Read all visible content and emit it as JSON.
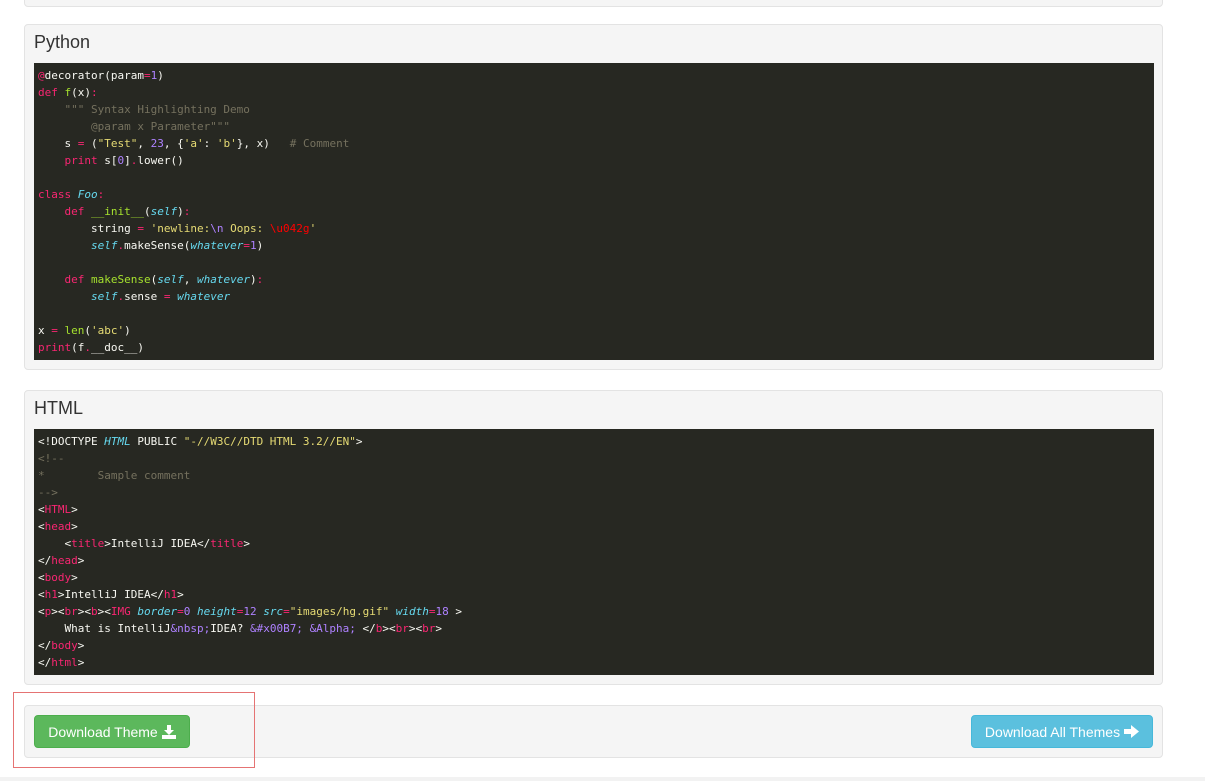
{
  "sections": [
    {
      "title": "Python",
      "lines": [
        [
          [
            "kw",
            "@"
          ],
          [
            "plain",
            "decorator(param"
          ],
          [
            "kw",
            "="
          ],
          [
            "num",
            "1"
          ],
          [
            "plain",
            ")"
          ]
        ],
        [
          [
            "kw",
            "def "
          ],
          [
            "func",
            "f"
          ],
          [
            "plain",
            "(x)"
          ],
          [
            "kw",
            ":"
          ]
        ],
        [
          [
            "comment",
            "    \"\"\" Syntax Highlighting Demo"
          ]
        ],
        [
          [
            "comment",
            "        @param x Parameter\"\"\""
          ]
        ],
        [
          [
            "plain",
            "    s "
          ],
          [
            "kw",
            "="
          ],
          [
            "plain",
            " ("
          ],
          [
            "str",
            "\"Test\""
          ],
          [
            "plain",
            ", "
          ],
          [
            "num",
            "23"
          ],
          [
            "plain",
            ", {"
          ],
          [
            "str",
            "'a'"
          ],
          [
            "plain",
            ": "
          ],
          [
            "str",
            "'b'"
          ],
          [
            "plain",
            "}, x)   "
          ],
          [
            "comment",
            "# Comment"
          ]
        ],
        [
          [
            "plain",
            "    "
          ],
          [
            "kw",
            "print"
          ],
          [
            "plain",
            " s["
          ],
          [
            "num",
            "0"
          ],
          [
            "plain",
            "]"
          ],
          [
            "kw",
            "."
          ],
          [
            "plain",
            "lower()"
          ]
        ],
        [],
        [
          [
            "kw",
            "class "
          ],
          [
            "cls",
            "Foo"
          ],
          [
            "kw",
            ":"
          ]
        ],
        [
          [
            "plain",
            "    "
          ],
          [
            "kw",
            "def "
          ],
          [
            "func",
            "__init__"
          ],
          [
            "plain",
            "("
          ],
          [
            "self",
            "self"
          ],
          [
            "plain",
            ")"
          ],
          [
            "kw",
            ":"
          ]
        ],
        [
          [
            "plain",
            "        string "
          ],
          [
            "kw",
            "="
          ],
          [
            "plain",
            " "
          ],
          [
            "str",
            "'newline:"
          ],
          [
            "num",
            "\\n"
          ],
          [
            "str",
            " Oops: "
          ],
          [
            "err",
            "\\u042g"
          ],
          [
            "str",
            "'"
          ]
        ],
        [
          [
            "plain",
            "        "
          ],
          [
            "self",
            "self"
          ],
          [
            "kw",
            "."
          ],
          [
            "plain",
            "makeSense("
          ],
          [
            "self",
            "whatever"
          ],
          [
            "kw",
            "="
          ],
          [
            "num",
            "1"
          ],
          [
            "plain",
            ")"
          ]
        ],
        [],
        [
          [
            "plain",
            "    "
          ],
          [
            "kw",
            "def "
          ],
          [
            "func",
            "makeSense"
          ],
          [
            "plain",
            "("
          ],
          [
            "self",
            "self"
          ],
          [
            "plain",
            ", "
          ],
          [
            "self",
            "whatever"
          ],
          [
            "plain",
            ")"
          ],
          [
            "kw",
            ":"
          ]
        ],
        [
          [
            "plain",
            "        "
          ],
          [
            "self",
            "self"
          ],
          [
            "kw",
            "."
          ],
          [
            "plain",
            "sense "
          ],
          [
            "kw",
            "="
          ],
          [
            "plain",
            " "
          ],
          [
            "self",
            "whatever"
          ]
        ],
        [],
        [
          [
            "plain",
            "x "
          ],
          [
            "kw",
            "="
          ],
          [
            "plain",
            " "
          ],
          [
            "func",
            "len"
          ],
          [
            "plain",
            "("
          ],
          [
            "str",
            "'abc'"
          ],
          [
            "plain",
            ")"
          ]
        ],
        [
          [
            "kw",
            "print"
          ],
          [
            "plain",
            "(f"
          ],
          [
            "kw",
            "."
          ],
          [
            "plain",
            "__doc__)"
          ]
        ]
      ]
    },
    {
      "title": "HTML",
      "lines": [
        [
          [
            "plain",
            "<!DOCTYPE "
          ],
          [
            "attr",
            "HTML"
          ],
          [
            "plain",
            " PUBLIC "
          ],
          [
            "str",
            "\"-//W3C//DTD HTML 3.2//EN\""
          ],
          [
            "plain",
            ">"
          ]
        ],
        [
          [
            "comment",
            "<!--"
          ]
        ],
        [
          [
            "comment",
            "*        Sample comment"
          ]
        ],
        [
          [
            "comment",
            "-->"
          ]
        ],
        [
          [
            "plain",
            "<"
          ],
          [
            "tag",
            "HTML"
          ],
          [
            "plain",
            ">"
          ]
        ],
        [
          [
            "plain",
            "<"
          ],
          [
            "tag",
            "head"
          ],
          [
            "plain",
            ">"
          ]
        ],
        [
          [
            "plain",
            "    <"
          ],
          [
            "tag",
            "title"
          ],
          [
            "plain",
            ">IntelliJ IDEA</"
          ],
          [
            "tag",
            "title"
          ],
          [
            "plain",
            ">"
          ]
        ],
        [
          [
            "plain",
            "</"
          ],
          [
            "tag",
            "head"
          ],
          [
            "plain",
            ">"
          ]
        ],
        [
          [
            "plain",
            "<"
          ],
          [
            "tag",
            "body"
          ],
          [
            "plain",
            ">"
          ]
        ],
        [
          [
            "plain",
            "<"
          ],
          [
            "tag",
            "h1"
          ],
          [
            "plain",
            ">IntelliJ IDEA</"
          ],
          [
            "tag",
            "h1"
          ],
          [
            "plain",
            ">"
          ]
        ],
        [
          [
            "plain",
            "<"
          ],
          [
            "tag",
            "p"
          ],
          [
            "plain",
            "><"
          ],
          [
            "tag",
            "br"
          ],
          [
            "plain",
            "><"
          ],
          [
            "tag",
            "b"
          ],
          [
            "plain",
            "><"
          ],
          [
            "tag",
            "IMG"
          ],
          [
            "plain",
            " "
          ],
          [
            "attr",
            "border"
          ],
          [
            "kw",
            "="
          ],
          [
            "num",
            "0"
          ],
          [
            "plain",
            " "
          ],
          [
            "attr",
            "height"
          ],
          [
            "kw",
            "="
          ],
          [
            "num",
            "12"
          ],
          [
            "plain",
            " "
          ],
          [
            "attr",
            "src"
          ],
          [
            "kw",
            "="
          ],
          [
            "str",
            "\"images/hg.gif\""
          ],
          [
            "plain",
            " "
          ],
          [
            "attr",
            "width"
          ],
          [
            "kw",
            "="
          ],
          [
            "num",
            "18"
          ],
          [
            "plain",
            " >"
          ]
        ],
        [
          [
            "plain",
            "    What is IntelliJ"
          ],
          [
            "num",
            "&nbsp;"
          ],
          [
            "plain",
            "IDEA? "
          ],
          [
            "num",
            "&#x00B7;"
          ],
          [
            "plain",
            " "
          ],
          [
            "num",
            "&Alpha;"
          ],
          [
            "plain",
            " </"
          ],
          [
            "tag",
            "b"
          ],
          [
            "plain",
            "><"
          ],
          [
            "tag",
            "br"
          ],
          [
            "plain",
            "><"
          ],
          [
            "tag",
            "br"
          ],
          [
            "plain",
            ">"
          ]
        ],
        [
          [
            "plain",
            "</"
          ],
          [
            "tag",
            "body"
          ],
          [
            "plain",
            ">"
          ]
        ],
        [
          [
            "plain",
            "</"
          ],
          [
            "tag",
            "html"
          ],
          [
            "plain",
            ">"
          ]
        ]
      ]
    }
  ],
  "footer": {
    "download_theme_label": "Download Theme",
    "download_theme_icon": "download-icon",
    "download_all_label": "Download All Themes",
    "download_all_icon": "arrow-right-icon"
  }
}
